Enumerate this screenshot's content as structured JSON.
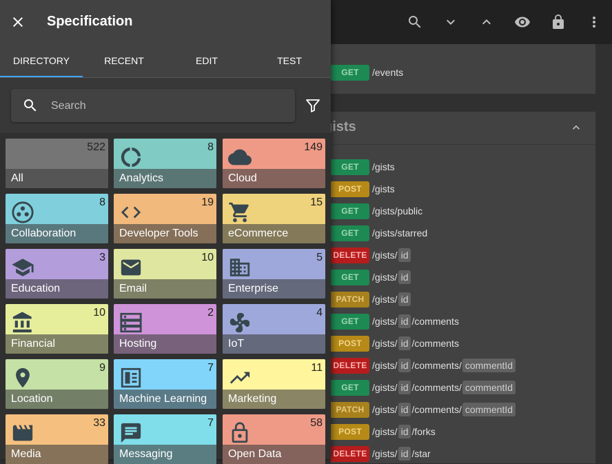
{
  "topbar": {
    "icons": [
      "search-icon",
      "chevron-down-icon",
      "chevron-up-icon",
      "eye-icon",
      "lock-icon",
      "more-vert-icon"
    ]
  },
  "events": {
    "method": "GET",
    "path": "/events"
  },
  "gists_section": {
    "title": "gists",
    "endpoints": [
      {
        "method": "GET",
        "segments": [
          "/gists"
        ]
      },
      {
        "method": "POST",
        "segments": [
          "/gists"
        ]
      },
      {
        "method": "GET",
        "segments": [
          "/gists/public"
        ]
      },
      {
        "method": "GET",
        "segments": [
          "/gists/starred"
        ]
      },
      {
        "method": "DELETE",
        "segments": [
          "/gists/",
          "{id}"
        ]
      },
      {
        "method": "GET",
        "segments": [
          "/gists/",
          "{id}"
        ]
      },
      {
        "method": "PATCH",
        "segments": [
          "/gists/",
          "{id}"
        ]
      },
      {
        "method": "GET",
        "segments": [
          "/gists/",
          "{id}",
          "/comments"
        ]
      },
      {
        "method": "POST",
        "segments": [
          "/gists/",
          "{id}",
          "/comments"
        ]
      },
      {
        "method": "DELETE",
        "segments": [
          "/gists/",
          "{id}",
          "/comments/",
          "{commentId}"
        ]
      },
      {
        "method": "GET",
        "segments": [
          "/gists/",
          "{id}",
          "/comments/",
          "{commentId}"
        ]
      },
      {
        "method": "PATCH",
        "segments": [
          "/gists/",
          "{id}",
          "/comments/",
          "{commentId}"
        ]
      },
      {
        "method": "POST",
        "segments": [
          "/gists/",
          "{id}",
          "/forks"
        ]
      },
      {
        "method": "DELETE",
        "segments": [
          "/gists/",
          "{id}",
          "/star"
        ]
      }
    ]
  },
  "method_colors": {
    "GET": {
      "bg": "#1d8a53",
      "fg": "#9fd8b4"
    },
    "POST": {
      "bg": "#b78a17",
      "fg": "#f0d48a"
    },
    "DELETE": {
      "bg": "#b71c1c",
      "fg": "#ffb3b3"
    },
    "PATCH": {
      "bg": "#a8811c",
      "fg": "#e6c982"
    }
  },
  "drawer": {
    "title": "Specification",
    "tabs": [
      "DIRECTORY",
      "RECENT",
      "EDIT",
      "TEST"
    ],
    "active_tab": "DIRECTORY",
    "search_placeholder": "Search"
  },
  "categories": [
    {
      "label": "All",
      "count": "522",
      "color": "#757575",
      "icon": "none"
    },
    {
      "label": "Analytics",
      "count": "8",
      "color": "#80cbc4",
      "icon": "donut-chart-icon"
    },
    {
      "label": "Cloud",
      "count": "149",
      "color": "#ef9a87",
      "icon": "cloud-icon"
    },
    {
      "label": "Collaboration",
      "count": "8",
      "color": "#7fd0dc",
      "icon": "bubble-chart-icon"
    },
    {
      "label": "Developer Tools",
      "count": "19",
      "color": "#f2b97c",
      "icon": "code-icon"
    },
    {
      "label": "eCommerce",
      "count": "15",
      "color": "#efd27c",
      "icon": "shopping-cart-icon"
    },
    {
      "label": "Education",
      "count": "3",
      "color": "#b39ddb",
      "icon": "school-icon"
    },
    {
      "label": "Email",
      "count": "10",
      "color": "#dfe6a0",
      "icon": "email-icon"
    },
    {
      "label": "Enterprise",
      "count": "5",
      "color": "#9fa8da",
      "icon": "building-icon"
    },
    {
      "label": "Financial",
      "count": "10",
      "color": "#e6ee9c",
      "icon": "bank-icon"
    },
    {
      "label": "Hosting",
      "count": "2",
      "color": "#ce93d8",
      "icon": "server-icon"
    },
    {
      "label": "IoT",
      "count": "4",
      "color": "#9fa8da",
      "icon": "fan-icon"
    },
    {
      "label": "Location",
      "count": "9",
      "color": "#c5e1a5",
      "icon": "location-pin-icon"
    },
    {
      "label": "Machine Learning",
      "count": "7",
      "color": "#81d4fa",
      "icon": "chip-icon"
    },
    {
      "label": "Marketing",
      "count": "11",
      "color": "#fff59d",
      "icon": "trending-up-icon"
    },
    {
      "label": "Media",
      "count": "33",
      "color": "#f5c07f",
      "icon": "movie-icon"
    },
    {
      "label": "Messaging",
      "count": "7",
      "color": "#80deea",
      "icon": "message-icon"
    },
    {
      "label": "Open Data",
      "count": "58",
      "color": "#ef9a87",
      "icon": "lock-open-icon"
    }
  ]
}
